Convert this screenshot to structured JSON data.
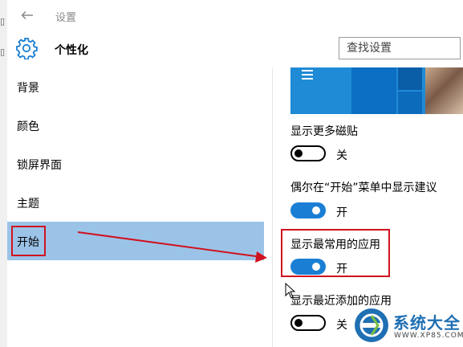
{
  "window": {
    "title": "设置"
  },
  "header": {
    "section_title": "个性化",
    "search_placeholder": "查找设置"
  },
  "sidebar": {
    "items": [
      {
        "label": "背景",
        "selected": false
      },
      {
        "label": "颜色",
        "selected": false
      },
      {
        "label": "锁屏界面",
        "selected": false
      },
      {
        "label": "主题",
        "selected": false
      },
      {
        "label": "开始",
        "selected": true
      }
    ],
    "selected_color": "#9bc3e8"
  },
  "content": {
    "settings": [
      {
        "label": "显示更多磁贴",
        "state": "关",
        "on": false
      },
      {
        "label": "偶尔在“开始”菜单中显示建议",
        "state": "开",
        "on": true
      },
      {
        "label": "显示最常用的应用",
        "state": "开",
        "on": true,
        "highlighted": true
      },
      {
        "label": "显示最近添加的应用",
        "state": "关",
        "on": false
      }
    ],
    "toggle_on_color": "#1a7fd4"
  },
  "annotation": {
    "color": "#d0121f"
  },
  "watermark": {
    "title": "系统大全",
    "url": "WWW.XP85.COM"
  }
}
